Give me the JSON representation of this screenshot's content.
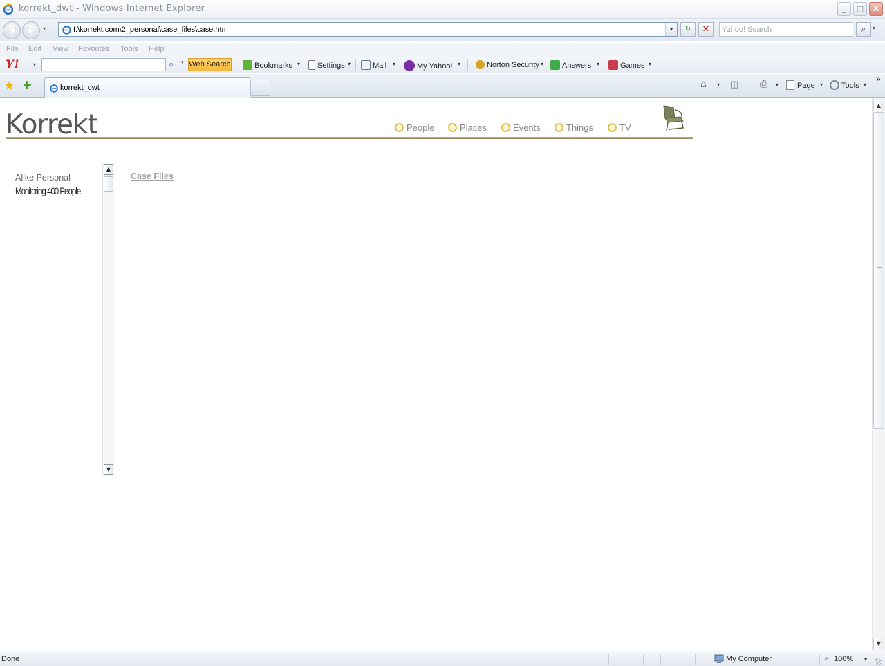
{
  "window": {
    "title": "korrekt_dwt - Windows Internet Explorer",
    "minimize_label": "_",
    "maximize_label": "□",
    "close_label": "X"
  },
  "address_bar": {
    "url": "I:\\korrekt.com\\2_personal\\case_files\\case.htm",
    "back_glyph": "◀",
    "forward_glyph": "▶",
    "refresh_glyph": "↻",
    "stop_glyph": "✕",
    "search_placeholder": "Yahoo! Search",
    "search_go_glyph": "⌕"
  },
  "menu": {
    "items": [
      "File",
      "Edit",
      "View",
      "Favorites",
      "Tools",
      "Help"
    ]
  },
  "yahoo_toolbar": {
    "logo": "Y!",
    "web_search_label": "Web Search",
    "search_glyph": "⌕",
    "items": {
      "bookmarks": "Bookmarks",
      "settings": "Settings",
      "mail": "Mail",
      "my_yahoo": "My Yahoo!",
      "norton": "Norton Security",
      "answers": "Answers",
      "games": "Games"
    }
  },
  "tabs": {
    "favorites_glyph": "★",
    "add_favorite_glyph": "✚",
    "active_tab_label": "korrekt_dwt",
    "commands": {
      "home_glyph": "⌂",
      "feeds_glyph": "◫",
      "print_glyph": "⎙",
      "page": "Page",
      "tools": "Tools",
      "more_glyph": "»"
    }
  },
  "page": {
    "logo": "Korrekt",
    "nav": [
      "People",
      "Places",
      "Events",
      "Things",
      "TV"
    ],
    "sidebar_title": "Alike Personal",
    "sidebar_subtitle": "Monitoring 400 People",
    "case_files_link": "Case Files",
    "colors": {
      "rule": "#a39e6b",
      "nav_dot": "#e2c24a",
      "link": "#a3a3a3"
    }
  },
  "status_bar": {
    "status": "Done",
    "zone": "My Computer",
    "zoom": "100%"
  },
  "icons": {
    "dropdown": "▾",
    "scroll_up": "▲",
    "scroll_down": "▼"
  }
}
